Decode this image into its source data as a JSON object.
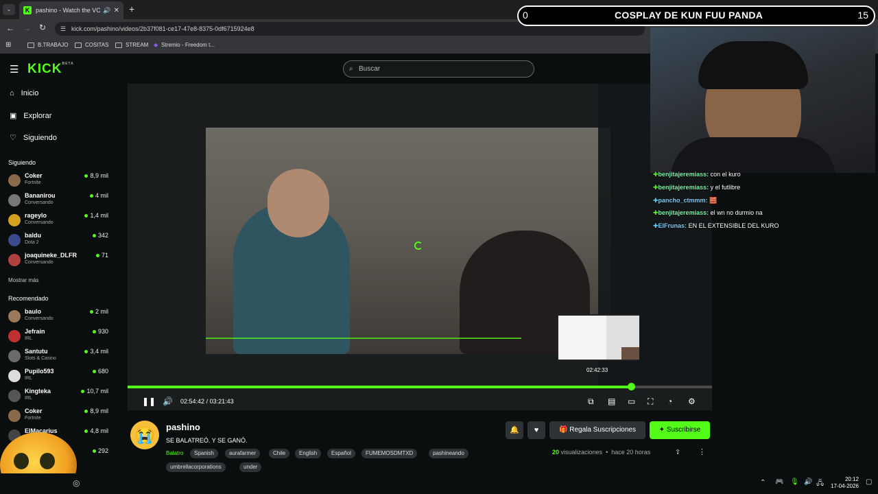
{
  "browser": {
    "tab_title": "pashino - Watch the VOD o",
    "url": "kick.com/pashino/videos/2b37f081-ce17-47e8-8375-0df6715924e8",
    "bookmarks": [
      "B.TRABAJO",
      "COSITAS",
      "STREAM",
      "Stremio - Freedom t..."
    ]
  },
  "nav": {
    "logo": "KICK",
    "logo_badge": "BETA",
    "search_placeholder": "Buscar"
  },
  "sidebar": {
    "menu": [
      "Inicio",
      "Explorar",
      "Siguiendo"
    ],
    "following_title": "Siguiendo",
    "following": [
      {
        "name": "Coker",
        "game": "Fortnite",
        "viewers": "8,9 mil"
      },
      {
        "name": "Bananirou",
        "game": "Conversando",
        "viewers": "4 mil"
      },
      {
        "name": "rageylo",
        "game": "Conversando",
        "viewers": "1,4 mil"
      },
      {
        "name": "baldu",
        "game": "Dota 2",
        "viewers": "342"
      },
      {
        "name": "joaquineke_DLFR",
        "game": "Conversando",
        "viewers": "71"
      }
    ],
    "show_more": "Mostrar más",
    "recommended_title": "Recomendado",
    "recommended": [
      {
        "name": "baulo",
        "game": "Conversando",
        "viewers": "2 mil"
      },
      {
        "name": "Jefrain",
        "game": "IRL",
        "viewers": "930"
      },
      {
        "name": "Santutu",
        "game": "Slots & Casino",
        "viewers": "3,4 mil"
      },
      {
        "name": "Pupilo593",
        "game": "IRL",
        "viewers": "680"
      },
      {
        "name": "Kingteka",
        "game": "IRL",
        "viewers": "10,7 mil"
      },
      {
        "name": "Coker",
        "game": "Fortnite",
        "viewers": "8,9 mil"
      },
      {
        "name": "ElMacarius",
        "game": "",
        "viewers": "4,8 mil"
      },
      {
        "name": "",
        "game": "",
        "viewers": "292"
      }
    ]
  },
  "player": {
    "current_time": "02:54:42",
    "separator": "/",
    "duration": "03:21:43",
    "preview_time": "02:42:33",
    "progress_fraction": 0.862
  },
  "video_info": {
    "channel": "pashino",
    "title": "SE BALATREÓ. Y SE GANÓ.",
    "category": "Balatro",
    "tags": [
      "Spanish",
      "aurafarmer",
      "Chile",
      "English",
      "Español",
      "FUMEMOSDMTXD",
      "pashineando",
      "umbrellacorporations",
      "under"
    ],
    "gift_label": "Regala Suscripciones",
    "subscribe_label": "Suscribirse",
    "views_count": "20",
    "views_label": "visualizaciones",
    "date": "hace 20 horas"
  },
  "overlay": {
    "goal_left": "0",
    "goal_title": "COSPLAY DE KUN FUU PANDA",
    "goal_right": "15",
    "chat": [
      {
        "user": "benjitajeremiass:",
        "text": "con el kuro"
      },
      {
        "user": "benjitajeremiass:",
        "text": "y el futlibre"
      },
      {
        "user": "pancho_ctmmm:",
        "text": "🧱"
      },
      {
        "user": "benjitajeremiass:",
        "text": "el wn no durmio na"
      },
      {
        "user": "ElFrunas:",
        "text": "EN EL EXTENSIBLE DEL KURO"
      }
    ]
  },
  "taskbar": {
    "time": "20:12",
    "date": "17-04-2026"
  },
  "colors": {
    "accent": "#53fc18",
    "background": "#0b0e0f"
  }
}
